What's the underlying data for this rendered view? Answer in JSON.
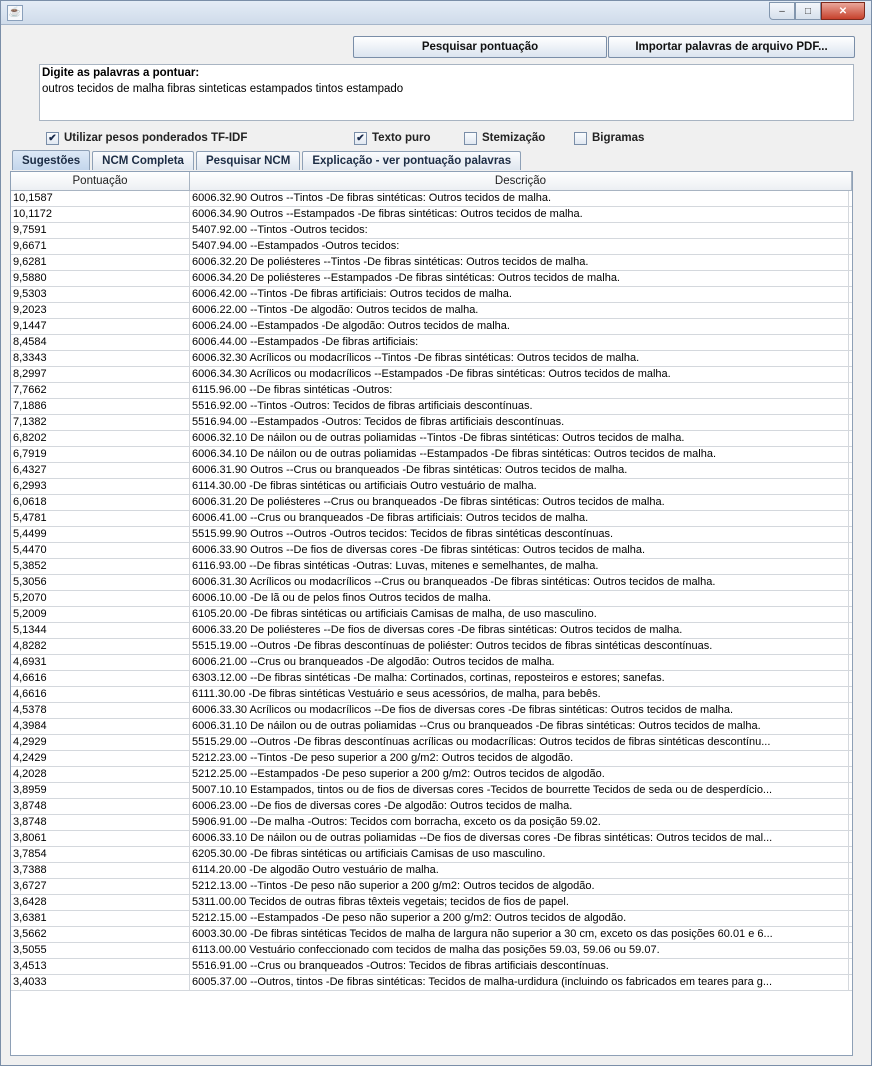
{
  "window": {
    "title": "",
    "minimize_glyph": "–",
    "maximize_glyph": "□",
    "close_glyph": "✕"
  },
  "toolbar": {
    "search_label": "Pesquisar pontuação",
    "import_label": "Importar palavras de arquivo PDF..."
  },
  "words": {
    "label": "Digite as palavras a pontuar:",
    "value": "outros tecidos de malha fibras sinteticas estampados tintos estampado"
  },
  "options": [
    {
      "label": "Utilizar pesos ponderados TF-IDF",
      "checked": true
    },
    {
      "label": "Texto puro",
      "checked": true
    },
    {
      "label": "Stemização",
      "checked": false
    },
    {
      "label": "Bigramas",
      "checked": false
    }
  ],
  "tabs": [
    {
      "label": "Sugestões",
      "active": true
    },
    {
      "label": "NCM Completa",
      "active": false
    },
    {
      "label": "Pesquisar NCM",
      "active": false
    },
    {
      "label": "Explicação - ver pontuação palavras",
      "active": false
    }
  ],
  "table": {
    "columns": [
      "Pontuação",
      "Descrição"
    ],
    "rows": [
      [
        "10,1587",
        "6006.32.90 Outros --Tintos -De fibras sintéticas: Outros tecidos de malha."
      ],
      [
        "10,1172",
        "6006.34.90 Outros --Estampados -De fibras sintéticas: Outros tecidos de malha."
      ],
      [
        "9,7591",
        "5407.92.00 --Tintos -Outros tecidos:"
      ],
      [
        "9,6671",
        "5407.94.00 --Estampados -Outros tecidos:"
      ],
      [
        "9,6281",
        "6006.32.20 De poliésteres --Tintos -De fibras sintéticas: Outros tecidos de malha."
      ],
      [
        "9,5880",
        "6006.34.20 De poliésteres --Estampados -De fibras sintéticas: Outros tecidos de malha."
      ],
      [
        "9,5303",
        "6006.42.00 --Tintos -De fibras artificiais: Outros tecidos de malha."
      ],
      [
        "9,2023",
        "6006.22.00 --Tintos -De algodão: Outros tecidos de malha."
      ],
      [
        "9,1447",
        "6006.24.00 --Estampados -De algodão: Outros tecidos de malha."
      ],
      [
        "8,4584",
        "6006.44.00 --Estampados -De fibras artificiais:"
      ],
      [
        "8,3343",
        "6006.32.30 Acrílicos ou modacrílicos --Tintos -De fibras sintéticas: Outros tecidos de malha."
      ],
      [
        "8,2997",
        "6006.34.30 Acrílicos ou modacrílicos --Estampados -De fibras sintéticas: Outros tecidos de malha."
      ],
      [
        "7,7662",
        "6115.96.00 --De fibras sintéticas -Outros:"
      ],
      [
        "7,1886",
        "5516.92.00 --Tintos -Outros: Tecidos de fibras artificiais descontínuas."
      ],
      [
        "7,1382",
        "5516.94.00 --Estampados -Outros: Tecidos de fibras artificiais descontínuas."
      ],
      [
        "6,8202",
        "6006.32.10 De náilon ou de outras poliamidas --Tintos -De fibras sintéticas: Outros tecidos de malha."
      ],
      [
        "6,7919",
        "6006.34.10 De náilon ou de outras poliamidas --Estampados -De fibras sintéticas: Outros tecidos de malha."
      ],
      [
        "6,4327",
        "6006.31.90 Outros --Crus ou branqueados -De fibras sintéticas: Outros tecidos de malha."
      ],
      [
        "6,2993",
        "6114.30.00 -De fibras sintéticas ou artificiais Outro vestuário de malha."
      ],
      [
        "6,0618",
        "6006.31.20 De poliésteres --Crus ou branqueados -De fibras sintéticas: Outros tecidos de malha."
      ],
      [
        "5,4781",
        "6006.41.00 --Crus ou branqueados -De fibras artificiais: Outros tecidos de malha."
      ],
      [
        "5,4499",
        "5515.99.90 Outros --Outros -Outros tecidos: Tecidos de fibras sintéticas descontínuas."
      ],
      [
        "5,4470",
        "6006.33.90 Outros --De fios de diversas cores -De fibras sintéticas: Outros tecidos de malha."
      ],
      [
        "5,3852",
        "6116.93.00 --De fibras sintéticas -Outras: Luvas, mitenes e semelhantes, de malha."
      ],
      [
        "5,3056",
        "6006.31.30 Acrílicos ou modacrílicos --Crus ou branqueados -De fibras sintéticas: Outros tecidos de malha."
      ],
      [
        "5,2070",
        "6006.10.00 -De lã ou de pelos finos Outros tecidos de malha."
      ],
      [
        "5,2009",
        "6105.20.00 -De fibras sintéticas ou artificiais Camisas de malha, de uso masculino."
      ],
      [
        "5,1344",
        "6006.33.20 De poliésteres --De fios de diversas cores -De fibras sintéticas: Outros tecidos de malha."
      ],
      [
        "4,8282",
        "5515.19.00 --Outros -De fibras descontínuas de poliéster: Outros tecidos de fibras sintéticas descontínuas."
      ],
      [
        "4,6931",
        "6006.21.00 --Crus ou branqueados -De algodão: Outros tecidos de malha."
      ],
      [
        "4,6616",
        "6303.12.00 --De fibras sintéticas -De malha: Cortinados, cortinas, reposteiros e estores; sanefas."
      ],
      [
        "4,6616",
        "6111.30.00 -De fibras sintéticas Vestuário e seus acessórios, de malha, para bebês."
      ],
      [
        "4,5378",
        "6006.33.30 Acrílicos ou modacrílicos --De fios de diversas cores -De fibras sintéticas: Outros tecidos de malha."
      ],
      [
        "4,3984",
        "6006.31.10 De náilon ou de outras poliamidas --Crus ou branqueados -De fibras sintéticas: Outros tecidos de malha."
      ],
      [
        "4,2929",
        "5515.29.00 --Outros -De fibras descontínuas acrílicas ou modacrílicas: Outros tecidos de fibras sintéticas descontínu..."
      ],
      [
        "4,2429",
        "5212.23.00 --Tintos -De peso superior a 200 g/m2: Outros tecidos de algodão."
      ],
      [
        "4,2028",
        "5212.25.00 --Estampados -De peso superior a 200 g/m2: Outros tecidos de algodão."
      ],
      [
        "3,8959",
        "5007.10.10 Estampados, tintos ou de fios de diversas cores -Tecidos de bourrette Tecidos de seda ou de desperdício..."
      ],
      [
        "3,8748",
        "6006.23.00 --De fios de diversas cores -De algodão: Outros tecidos de malha."
      ],
      [
        "3,8748",
        "5906.91.00 --De malha -Outros: Tecidos com borracha, exceto os da posição 59.02."
      ],
      [
        "3,8061",
        "6006.33.10 De náilon ou de outras poliamidas --De fios de diversas cores -De fibras sintéticas: Outros tecidos de mal..."
      ],
      [
        "3,7854",
        "6205.30.00 -De fibras sintéticas ou artificiais Camisas de uso masculino."
      ],
      [
        "3,7388",
        "6114.20.00 -De algodão Outro vestuário de malha."
      ],
      [
        "3,6727",
        "5212.13.00 --Tintos -De peso não superior a 200 g/m2: Outros tecidos de algodão."
      ],
      [
        "3,6428",
        "5311.00.00 Tecidos de outras fibras têxteis vegetais; tecidos de fios de papel."
      ],
      [
        "3,6381",
        "5212.15.00 --Estampados -De peso não superior a 200 g/m2: Outros tecidos de algodão."
      ],
      [
        "3,5662",
        "6003.30.00 -De fibras sintéticas Tecidos de malha de largura não superior a 30 cm, exceto os das posições 60.01 e 6..."
      ],
      [
        "3,5055",
        "6113.00.00 Vestuário confeccionado com tecidos de malha das posições 59.03, 59.06 ou 59.07."
      ],
      [
        "3,4513",
        "5516.91.00 --Crus ou branqueados -Outros: Tecidos de fibras artificiais descontínuas."
      ],
      [
        "3,4033",
        "6005.37.00 --Outros, tintos -De fibras sintéticas: Tecidos de malha-urdidura (incluindo os fabricados em teares para g..."
      ]
    ]
  }
}
